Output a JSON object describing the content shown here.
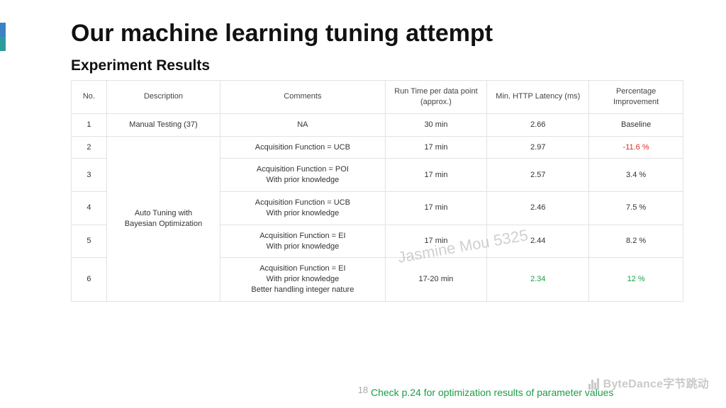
{
  "title": "Our machine learning tuning attempt",
  "subtitle": "Experiment Results",
  "headers": {
    "no": "No.",
    "desc": "Description",
    "comments": "Comments",
    "runtime": "Run Time per data point (approx.)",
    "latency": "Min. HTTP Latency (ms)",
    "pct": "Percentage Improvement"
  },
  "desc_row1": "Manual Testing (37)",
  "desc_group": "Auto Tuning with\nBayesian Optimization",
  "rows": [
    {
      "no": "1",
      "comments": "NA",
      "runtime": "30 min",
      "latency": "2.66",
      "pct": "Baseline",
      "pct_class": ""
    },
    {
      "no": "2",
      "comments": "Acquisition Function = UCB",
      "runtime": "17 min",
      "latency": "2.97",
      "pct": "-11.6 %",
      "pct_class": "red"
    },
    {
      "no": "3",
      "comments": "Acquisition Function = POI\nWith prior knowledge",
      "runtime": "17 min",
      "latency": "2.57",
      "pct": "3.4 %",
      "pct_class": ""
    },
    {
      "no": "4",
      "comments": "Acquisition Function = UCB\nWith prior knowledge",
      "runtime": "17 min",
      "latency": "2.46",
      "pct": "7.5 %",
      "pct_class": ""
    },
    {
      "no": "5",
      "comments": "Acquisition Function = EI\nWith prior knowledge",
      "runtime": "17 min",
      "latency": "2.44",
      "pct": "8.2 %",
      "pct_class": ""
    },
    {
      "no": "6",
      "comments": "Acquisition Function = EI\nWith prior knowledge\nBetter handling integer nature",
      "runtime": "17-20 min",
      "latency": "2.34",
      "pct": "12 %",
      "pct_class": "green",
      "latency_class": "green"
    }
  ],
  "watermark": "Jasmine Mou 5325",
  "page_number": "18",
  "footer_note": "Check p.24 for optimization results of parameter values",
  "brand": "ByteDance字节跳动"
}
